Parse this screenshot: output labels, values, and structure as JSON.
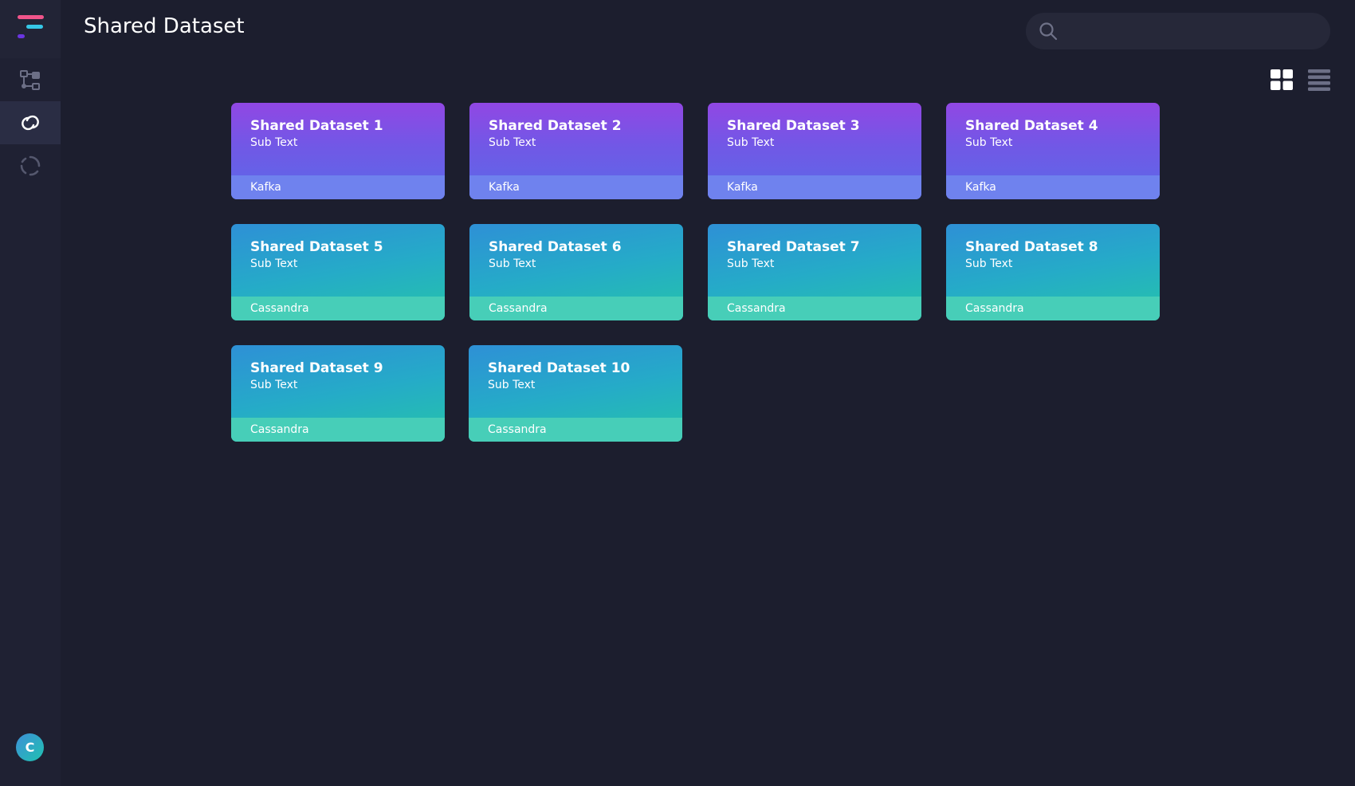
{
  "header": {
    "title": "Shared Dataset",
    "search_placeholder": ""
  },
  "sidebar": {
    "items": [
      {
        "name": "pipeline-icon",
        "active": false
      },
      {
        "name": "link-icon",
        "active": true
      },
      {
        "name": "refresh-icon",
        "active": false
      }
    ],
    "avatar_initial": "C"
  },
  "view": {
    "mode": "grid"
  },
  "datasets": [
    {
      "title": "Shared Dataset 1",
      "sub": "Sub Text",
      "source": "Kafka"
    },
    {
      "title": "Shared Dataset 2",
      "sub": "Sub Text",
      "source": "Kafka"
    },
    {
      "title": "Shared Dataset 3",
      "sub": "Sub Text",
      "source": "Kafka"
    },
    {
      "title": "Shared Dataset 4",
      "sub": "Sub Text",
      "source": "Kafka"
    },
    {
      "title": "Shared Dataset 5",
      "sub": "Sub Text",
      "source": "Cassandra"
    },
    {
      "title": "Shared Dataset 6",
      "sub": "Sub Text",
      "source": "Cassandra"
    },
    {
      "title": "Shared Dataset 7",
      "sub": "Sub Text",
      "source": "Cassandra"
    },
    {
      "title": "Shared Dataset 8",
      "sub": "Sub Text",
      "source": "Cassandra"
    },
    {
      "title": "Shared Dataset 9",
      "sub": "Sub Text",
      "source": "Cassandra"
    },
    {
      "title": "Shared Dataset 10",
      "sub": "Sub Text",
      "source": "Cassandra"
    }
  ],
  "colors": {
    "background": "#1c1e2e",
    "sidebar": "#1f2133",
    "kafka_accent": "#7158e6",
    "cassandra_accent": "#25c4a9"
  }
}
